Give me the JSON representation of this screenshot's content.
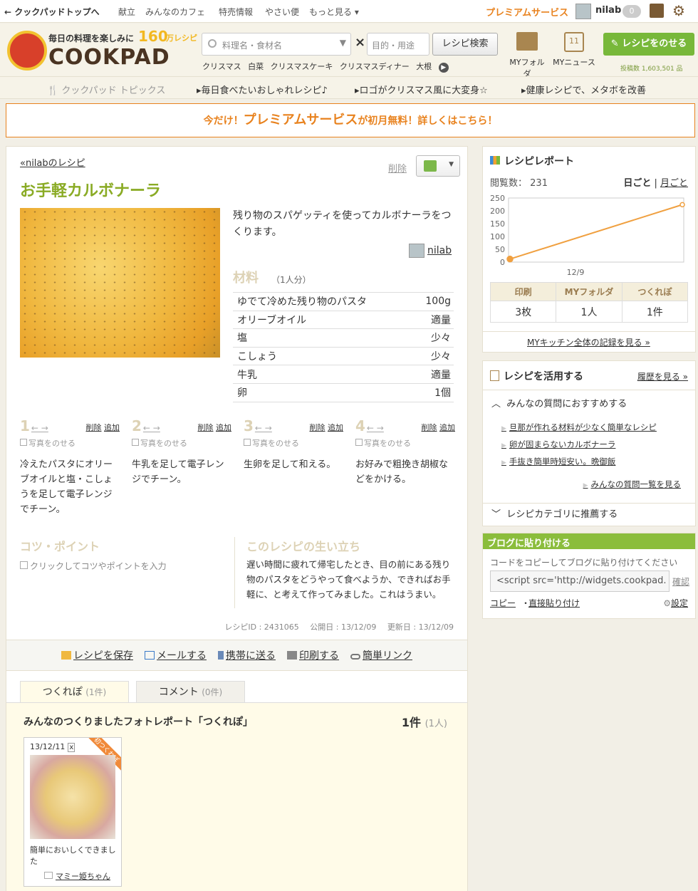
{
  "topnav": {
    "home": "クックパッドトップへ",
    "links": [
      "献立",
      "みんなのカフェ",
      "特売情報",
      "やさい便",
      "もっと見る"
    ],
    "premium": "プレミアムサービス",
    "username": "nilab",
    "notifications": "0"
  },
  "header": {
    "logo_tagline": "毎日の料理を楽しみに",
    "logo_count": "160",
    "logo_count_unit": "万レシピ",
    "logo_text": "COOKPAD",
    "search_placeholder": "料理名・食材名",
    "purpose_placeholder": "目的・用途",
    "search_button": "レシピ検索",
    "keywords": [
      "クリスマス",
      "白菜",
      "クリスマスケーキ",
      "クリスマスディナー",
      "大根"
    ],
    "my_folder": "MYフォルダ",
    "my_news": "MYニュース",
    "my_news_day": "11",
    "post_button": "レシピをのせる",
    "post_count": "投稿数 1,603,501 品"
  },
  "topics": {
    "title": "クックパッド トピックス",
    "items": [
      "毎日食べたいおしゃれレシピ♪",
      "ロゴがクリスマス風に大変身☆",
      "健康レシピで、メタボを改善"
    ]
  },
  "banner": {
    "pre": "今だけ！",
    "main": "プレミアムサービス",
    "mid": "が初月無料！",
    "post": "詳しくはこちら！"
  },
  "recipe": {
    "back_link": "«nilabのレシピ",
    "delete": "削除",
    "title": "お手軽カルボナーラ",
    "description": "残り物のスパゲッティを使ってカルボナーラをつくります。",
    "author": "nilab",
    "ingredients_title": "材料",
    "servings": "（1人分）",
    "ingredients": [
      {
        "name": "ゆでて冷めた残り物のパスタ",
        "qty": "100g"
      },
      {
        "name": "オリーブオイル",
        "qty": "適量"
      },
      {
        "name": "塩",
        "qty": "少々"
      },
      {
        "name": "こしょう",
        "qty": "少々"
      },
      {
        "name": "牛乳",
        "qty": "適量"
      },
      {
        "name": "卵",
        "qty": "1個"
      }
    ],
    "step_ops": {
      "delete": "削除",
      "add": "追加",
      "photo": "写真をのせる",
      "arrows": "← →"
    },
    "steps": [
      {
        "num": "1",
        "text": "冷えたパスタにオリーブオイルと塩・こしょうを足して電子レンジでチーン。"
      },
      {
        "num": "2",
        "text": "牛乳を足して電子レンジでチーン。"
      },
      {
        "num": "3",
        "text": "生卵を足して和える。"
      },
      {
        "num": "4",
        "text": "お好みで粗挽き胡椒などをかける。"
      }
    ],
    "tips_title": "コツ・ポイント",
    "tips_placeholder": "クリックしてコツやポイントを入力",
    "origin_title": "このレシピの生い立ち",
    "origin_text": "遅い時間に疲れて帰宅したとき、目の前にある残り物のパスタをどうやって食べようか、できればお手軽に、と考えて作ってみました。これはうまい。",
    "recipe_id": "レシピID : 2431065",
    "published": "公開日 : 13/12/09",
    "updated": "更新日 : 13/12/09"
  },
  "actions": [
    "レシピを保存",
    "メールする",
    "携帯に送る",
    "印刷する",
    "簡単リンク"
  ],
  "tabs": {
    "tsukurepo": "つくれぽ",
    "tsukurepo_count": "(1件)",
    "comment": "コメント",
    "comment_count": "(0件)"
  },
  "tsukurepo": {
    "title": "みんなのつくりましたフォトレポート「つくれぽ」",
    "count": "1",
    "count_unit": "件",
    "count_people": "(1人)",
    "card": {
      "date": "13/12/11",
      "remove": "x",
      "ribbon": "初つくれぽ",
      "comment": "簡単においしくできました",
      "user": "マミー姫ちゃん"
    }
  },
  "report": {
    "title": "レシピレポート",
    "views_label": "閲覧数：",
    "views": "231",
    "daily": "日ごと",
    "monthly": "月ごと",
    "headers": [
      "印刷",
      "MYフォルダ",
      "つくれぽ"
    ],
    "values": [
      "3枚",
      "1人",
      "1件"
    ],
    "kitchen_link": "MYキッチン全体の記録を見る »"
  },
  "chart_data": {
    "type": "line",
    "x": [
      "12/9",
      ""
    ],
    "series": [
      {
        "values": [
          12,
          224
        ]
      }
    ],
    "ylim": [
      0,
      250
    ],
    "yticks": [
      0,
      50,
      100,
      150,
      200,
      250
    ],
    "xlabel": "",
    "ylabel": "",
    "grid": false,
    "color": "#f0a040"
  },
  "use": {
    "title": "レシピを活用する",
    "history": "履歴を見る »",
    "questions_head": "みんなの質問におすすめする",
    "questions": [
      "旦那が作れる材料が少なく簡単なレシピ",
      "卵が固まらないカルボナーラ",
      "手抜き簡単時短安い。晩御飯"
    ],
    "all_questions": "みんなの質問一覧を見る",
    "category_head": "レシピカテゴリに推薦する"
  },
  "blog": {
    "title": "ブログに貼り付ける",
    "desc": "コードをコピーしてブログに貼り付けてください",
    "code": "<script src='http://widgets.cookpad.",
    "confirm": "確認",
    "copy": "コピー",
    "direct": "直接貼り付け",
    "settings": "設定"
  },
  "colors": {
    "accent_green": "#8aab25",
    "accent_orange": "#e8821e",
    "brand_brown": "#4a3422"
  }
}
